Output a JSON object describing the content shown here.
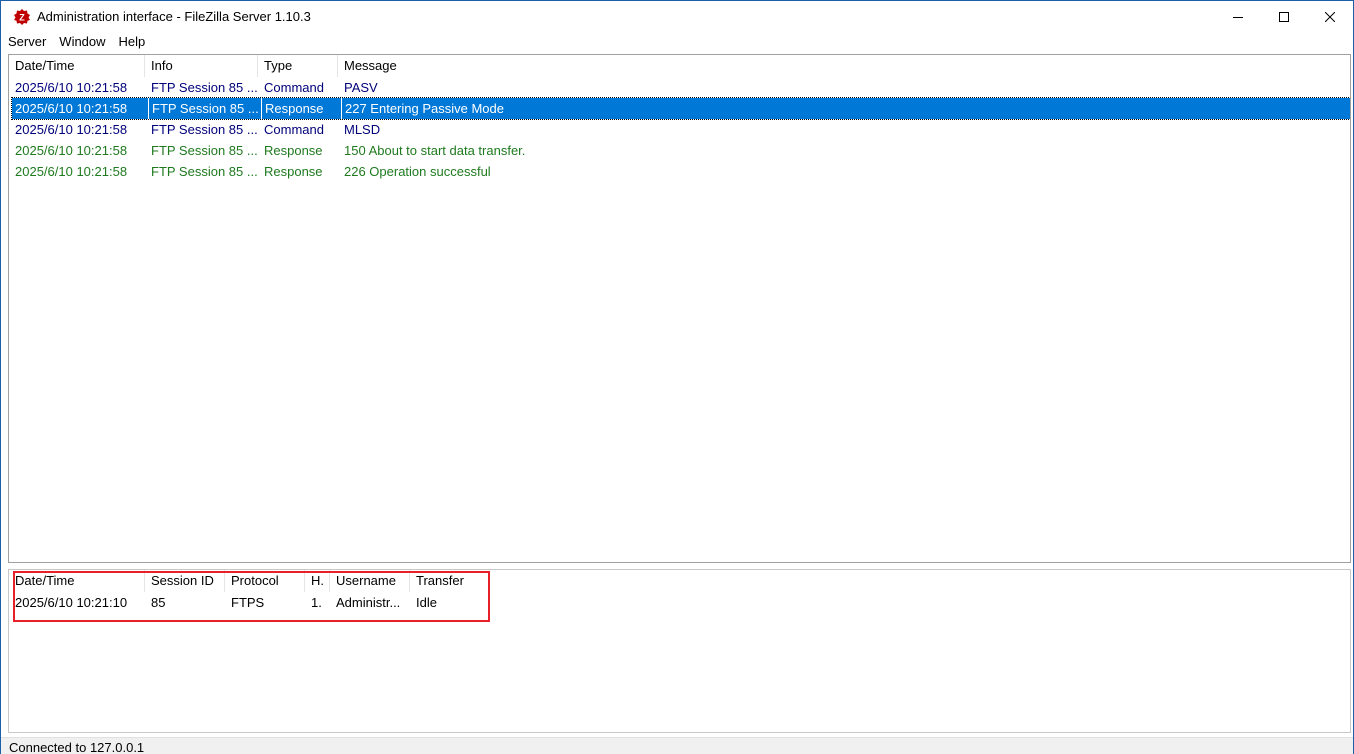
{
  "window": {
    "title": "Administration interface - FileZilla Server 1.10.3",
    "controls": {
      "minimize": "minimize",
      "maximize": "maximize",
      "close": "close"
    }
  },
  "menu": [
    "Server",
    "Window",
    "Help"
  ],
  "log": {
    "columns": [
      "Date/Time",
      "Info",
      "Type",
      "Message"
    ],
    "rows": [
      {
        "datetime": "2025/6/10 10:21:58",
        "info": "FTP Session 85 ...",
        "type": "Command",
        "message": "PASV",
        "kind": "command",
        "selected": false
      },
      {
        "datetime": "2025/6/10 10:21:58",
        "info": "FTP Session 85 ...",
        "type": "Response",
        "message": "227 Entering Passive Mode",
        "kind": "response",
        "selected": true
      },
      {
        "datetime": "2025/6/10 10:21:58",
        "info": "FTP Session 85 ...",
        "type": "Command",
        "message": "MLSD",
        "kind": "command",
        "selected": false
      },
      {
        "datetime": "2025/6/10 10:21:58",
        "info": "FTP Session 85 ...",
        "type": "Response",
        "message": "150 About to start data transfer.",
        "kind": "response",
        "selected": false
      },
      {
        "datetime": "2025/6/10 10:21:58",
        "info": "FTP Session 85 ...",
        "type": "Response",
        "message": "226 Operation successful",
        "kind": "response",
        "selected": false
      }
    ]
  },
  "sessions": {
    "columns": [
      "Date/Time",
      "Session ID",
      "Protocol",
      "H.",
      "Username",
      "Transfer"
    ],
    "rows": [
      {
        "datetime": "2025/6/10 10:21:10",
        "session_id": "85",
        "protocol": "FTPS",
        "h": "1.",
        "username": "Administr...",
        "transfer": "Idle"
      }
    ]
  },
  "status": {
    "text": "Connected to 127.0.0.1"
  },
  "colors": {
    "command": "#00007b",
    "response": "#1f7a1f",
    "selection": "#0078d7",
    "highlight": "#e8202a"
  }
}
